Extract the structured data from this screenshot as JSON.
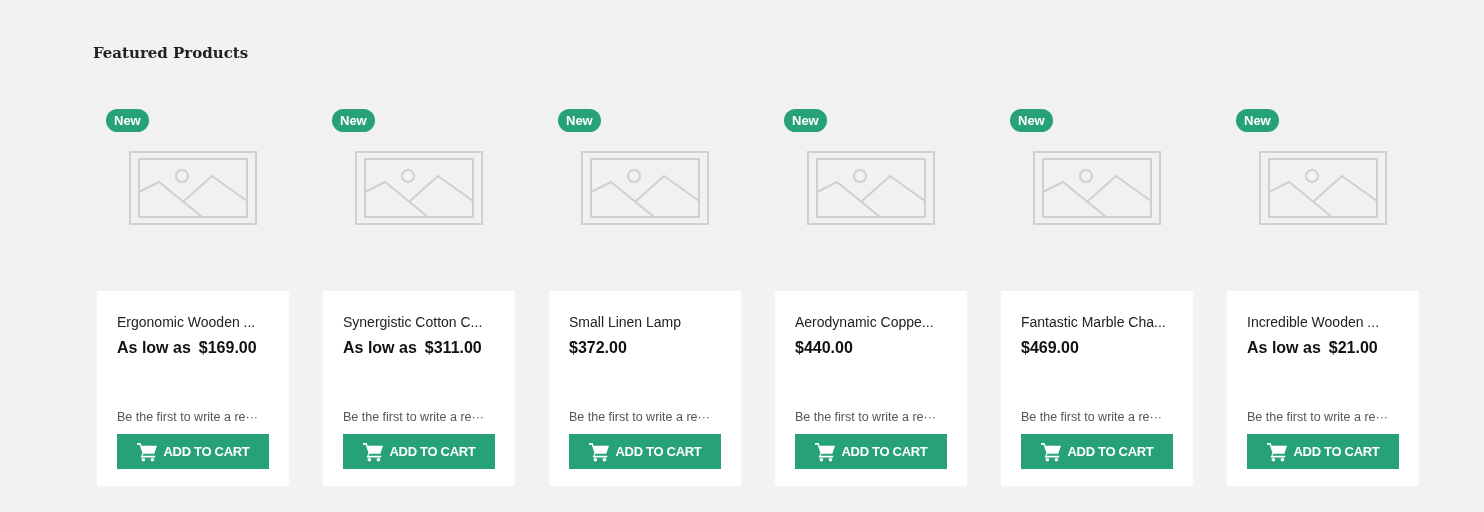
{
  "heading": "Featured Products",
  "products": [
    {
      "badge": "New",
      "name": "Ergonomic Wooden ...",
      "price_prefix": "As low as",
      "price": "$169.00",
      "review_link": "Be the first to write a re···",
      "button": "ADD TO CART"
    },
    {
      "badge": "New",
      "name": "Synergistic Cotton C...",
      "price_prefix": "As low as",
      "price": "$311.00",
      "review_link": "Be the first to write a re···",
      "button": "ADD TO CART"
    },
    {
      "badge": "New",
      "name": "Small Linen Lamp",
      "price": "$372.00",
      "review_link": "Be the first to write a re···",
      "button": "ADD TO CART"
    },
    {
      "badge": "New",
      "name": "Aerodynamic Coppe...",
      "price": "$440.00",
      "review_link": "Be the first to write a re···",
      "button": "ADD TO CART"
    },
    {
      "badge": "New",
      "name": "Fantastic Marble Cha...",
      "price": "$469.00",
      "review_link": "Be the first to write a re···",
      "button": "ADD TO CART"
    },
    {
      "badge": "New",
      "name": "Incredible Wooden ...",
      "price_prefix": "As low as",
      "price": "$21.00",
      "review_link": "Be the first to write a re···",
      "button": "ADD TO CART"
    }
  ]
}
